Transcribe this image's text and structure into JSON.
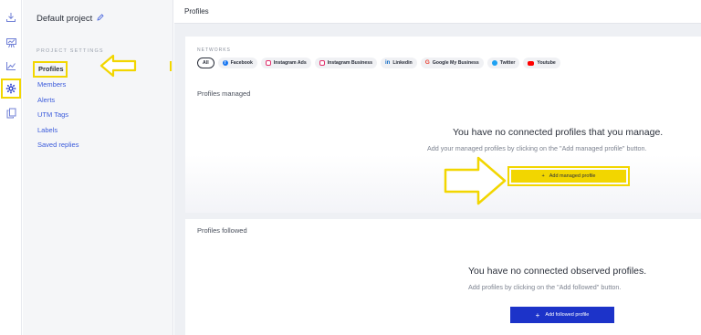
{
  "rail": {
    "items": [
      {
        "name": "download-icon"
      },
      {
        "name": "chart-stand-icon"
      },
      {
        "name": "line-chart-icon"
      },
      {
        "name": "settings-gear-icon"
      },
      {
        "name": "copy-icon"
      }
    ]
  },
  "sidebar": {
    "project_name": "Default project",
    "section_label": "PROJECT SETTINGS",
    "items": [
      {
        "label": "Profiles"
      },
      {
        "label": "Members"
      },
      {
        "label": "Alerts"
      },
      {
        "label": "UTM Tags"
      },
      {
        "label": "Labels"
      },
      {
        "label": "Saved replies"
      }
    ]
  },
  "main": {
    "title": "Profiles",
    "networks": {
      "label": "NETWORKS",
      "chips": [
        {
          "label": "All",
          "color": "#2a2f3a"
        },
        {
          "label": "Facebook",
          "color": "#1877f2"
        },
        {
          "label": "Instagram Ads",
          "color": "#e1306c"
        },
        {
          "label": "Instagram Business",
          "color": "#e1306c"
        },
        {
          "label": "Linkedin",
          "color": "#0a66c2"
        },
        {
          "label": "Google My Business",
          "color": "#ea4335"
        },
        {
          "label": "Twitter",
          "color": "#1da1f2"
        },
        {
          "label": "Youtube",
          "color": "#ff0000"
        }
      ]
    },
    "managed": {
      "title": "Profiles managed",
      "empty_title": "You have no connected profiles that you manage.",
      "empty_sub": "Add your managed profiles by clicking on the \"Add managed profile\" button.",
      "button_label": "Add managed profile"
    },
    "followed": {
      "title": "Profiles followed",
      "empty_title": "You have no connected observed profiles.",
      "empty_sub": "Add profiles by clicking on the \"Add followed\" button.",
      "button_label": "Add followed profile"
    }
  },
  "colors": {
    "highlight": "#f2d600",
    "primary_blue": "#1c33c9",
    "link": "#3b5bdb"
  }
}
